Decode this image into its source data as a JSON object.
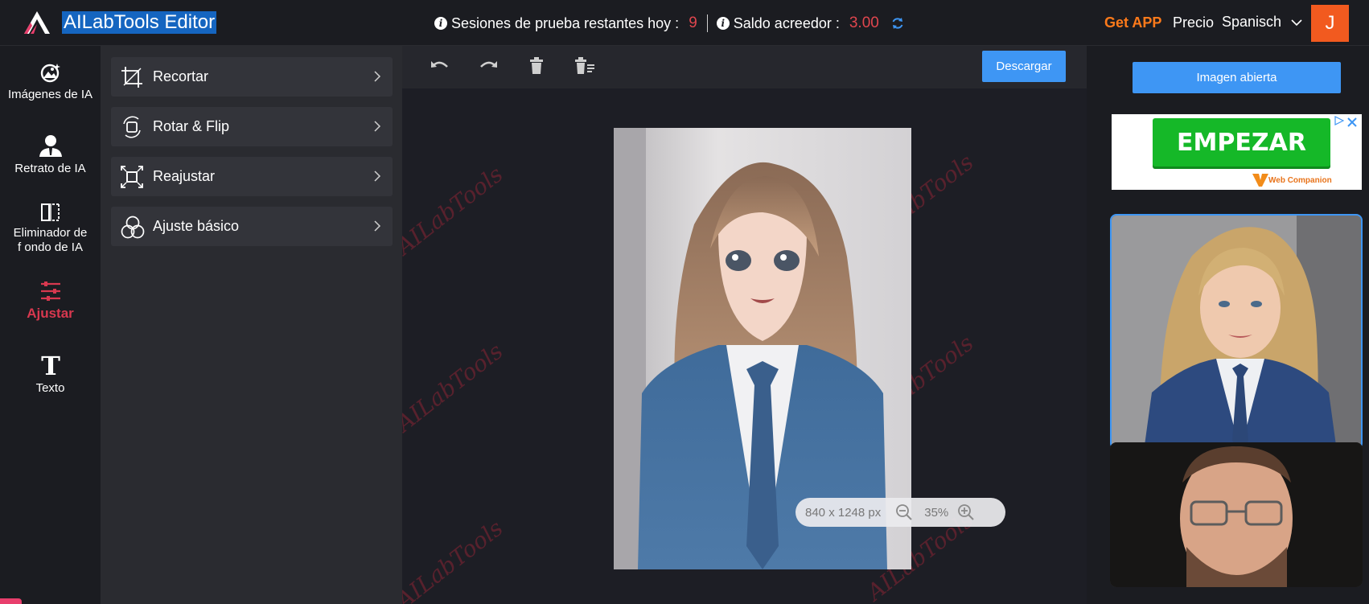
{
  "header": {
    "title": "AILabTools Editor",
    "trial_label": "Sesiones de prueba restantes hoy :",
    "trial_count": "9",
    "credit_label": "Saldo acreedor :",
    "credit_value": "3.00",
    "get_app": "Get APP",
    "pricing": "Precio",
    "language": "Spanisch",
    "avatar_letter": "J"
  },
  "sidebar": {
    "items": [
      {
        "label": "Imágenes de IA",
        "icon": "ai-image-icon"
      },
      {
        "label": "Retrato de IA",
        "icon": "portrait-icon"
      },
      {
        "label": "Eliminador de f ondo de IA",
        "icon": "background-remover-icon"
      },
      {
        "label": "Ajustar",
        "icon": "adjust-sliders-icon",
        "active": true
      },
      {
        "label": "Texto",
        "icon": "text-icon"
      }
    ]
  },
  "tools": {
    "items": [
      {
        "label": "Recortar",
        "icon": "crop-icon"
      },
      {
        "label": "Rotar & Flip",
        "icon": "rotate-flip-icon"
      },
      {
        "label": "Reajustar",
        "icon": "resize-icon"
      },
      {
        "label": "Ajuste básico",
        "icon": "basic-adjust-icon"
      }
    ]
  },
  "toolbar": {
    "download_label": "Descargar"
  },
  "canvas": {
    "watermark": "AILabTools",
    "dimensions": "840 x 1248 px",
    "zoom": "35%"
  },
  "right_panel": {
    "open_image_label": "Imagen abierta",
    "ad_button": "EMPEZAR",
    "ad_brand": "Web Companion"
  },
  "colors": {
    "accent_blue": "#3e96f4",
    "active_red": "#d8384f",
    "get_app_orange": "#ff7a1a",
    "avatar_orange": "#f25a1f",
    "ad_green": "#15b828"
  }
}
